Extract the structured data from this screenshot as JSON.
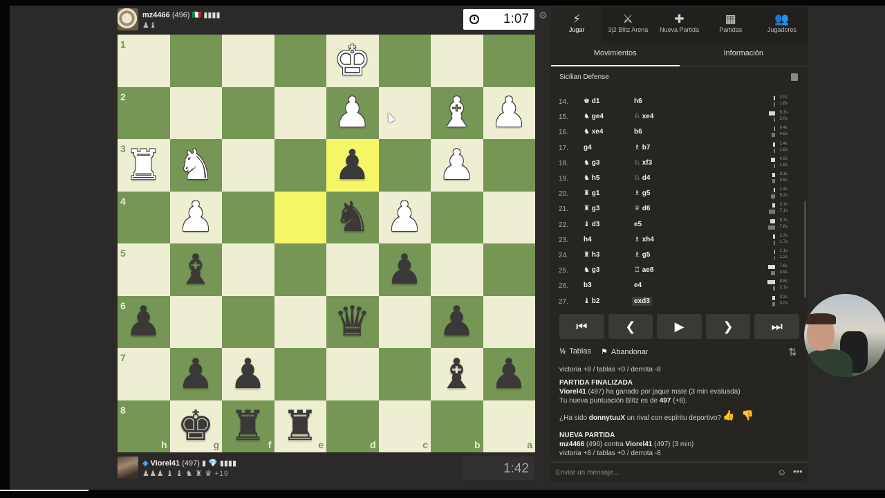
{
  "top_player": {
    "username": "mz4466",
    "rating": "(496)",
    "flag": "🇮🇹 ▮▮▮▮",
    "captured": "♟♝",
    "clock": "1:07"
  },
  "bottom_player": {
    "username": "Viorel41",
    "rating": "(497)",
    "flag": "▮ 💎 ▮▮▮▮",
    "captured": "♟♟♟ ♝ ♝ ♞ ♜ ♛",
    "advantage": "+19",
    "clock": "1:42"
  },
  "board": {
    "ranks": [
      "1",
      "2",
      "3",
      "4",
      "5",
      "6",
      "7",
      "8"
    ],
    "files": [
      "h",
      "g",
      "f",
      "e",
      "d",
      "c",
      "b",
      "a"
    ],
    "pieces": [
      {
        "r": 0,
        "c": 4,
        "g": "♚",
        "s": "w"
      },
      {
        "r": 1,
        "c": 4,
        "g": "♟",
        "s": "w"
      },
      {
        "r": 1,
        "c": 6,
        "g": "♝",
        "s": "w"
      },
      {
        "r": 1,
        "c": 7,
        "g": "♟",
        "s": "w"
      },
      {
        "r": 2,
        "c": 0,
        "g": "♜",
        "s": "w"
      },
      {
        "r": 2,
        "c": 1,
        "g": "♞",
        "s": "w"
      },
      {
        "r": 2,
        "c": 4,
        "g": "♟",
        "s": "b"
      },
      {
        "r": 2,
        "c": 6,
        "g": "♟",
        "s": "w"
      },
      {
        "r": 3,
        "c": 1,
        "g": "♟",
        "s": "w"
      },
      {
        "r": 3,
        "c": 4,
        "g": "♞",
        "s": "b"
      },
      {
        "r": 3,
        "c": 5,
        "g": "♟",
        "s": "w"
      },
      {
        "r": 4,
        "c": 1,
        "g": "♝",
        "s": "b"
      },
      {
        "r": 4,
        "c": 5,
        "g": "♟",
        "s": "b"
      },
      {
        "r": 5,
        "c": 0,
        "g": "♟",
        "s": "b"
      },
      {
        "r": 5,
        "c": 4,
        "g": "♛",
        "s": "b"
      },
      {
        "r": 5,
        "c": 6,
        "g": "♟",
        "s": "b"
      },
      {
        "r": 6,
        "c": 1,
        "g": "♟",
        "s": "b"
      },
      {
        "r": 6,
        "c": 2,
        "g": "♟",
        "s": "b"
      },
      {
        "r": 6,
        "c": 6,
        "g": "♝",
        "s": "b"
      },
      {
        "r": 6,
        "c": 7,
        "g": "♟",
        "s": "b"
      },
      {
        "r": 7,
        "c": 1,
        "g": "♚",
        "s": "b"
      },
      {
        "r": 7,
        "c": 2,
        "g": "♜",
        "s": "b"
      },
      {
        "r": 7,
        "c": 3,
        "g": "♜",
        "s": "b"
      }
    ],
    "highlights": [
      [
        2,
        4
      ],
      [
        3,
        3
      ]
    ]
  },
  "nav": [
    {
      "icon": "⚡",
      "label": "Jugar"
    },
    {
      "icon": "⚔",
      "label": "3|2 Blitz Arena"
    },
    {
      "icon": "✚",
      "label": "Nueva Partida"
    },
    {
      "icon": "▦",
      "label": "Partidas"
    },
    {
      "icon": "👥",
      "label": "Jugadores"
    }
  ],
  "tabs": [
    "Movimientos",
    "Información"
  ],
  "opening": "Sicilian Defense",
  "moves": [
    {
      "n": "14.",
      "w": "♚ d1",
      "b": "h6",
      "tw": "2.0s",
      "tb": "1.8s",
      "bw": 2,
      "bb": 2
    },
    {
      "n": "15.",
      "w": "♞ ge4",
      "b": "♘ xe4",
      "tw": "6.7s",
      "tb": "2.0s",
      "bw": 9,
      "bb": 2
    },
    {
      "n": "16.",
      "w": "♞ xe4",
      "b": "b6",
      "tw": "0.4s",
      "tb": "4.6s",
      "bw": 1,
      "bb": 5
    },
    {
      "n": "17.",
      "w": "g4",
      "b": "♗ b7",
      "tw": "2.4s",
      "tb": "1.8s",
      "bw": 3,
      "bb": 2
    },
    {
      "n": "18.",
      "w": "♞ g3",
      "b": "♘ xf3",
      "tw": "4.9s",
      "tb": "1.9s",
      "bw": 6,
      "bb": 2
    },
    {
      "n": "19.",
      "w": "♞ h5",
      "b": "♘ d4",
      "tw": "3.1s",
      "tb": "3.5s",
      "bw": 4,
      "bb": 4
    },
    {
      "n": "20.",
      "w": "♜ g1",
      "b": "♗ g5",
      "tw": "1.4s",
      "tb": "5.2s",
      "bw": 2,
      "bb": 6
    },
    {
      "n": "21.",
      "w": "♜ g3",
      "b": "♕ d6",
      "tw": "3.1s",
      "tb": "7.1s",
      "bw": 4,
      "bb": 9
    },
    {
      "n": "22.",
      "w": "♝ d3",
      "b": "e5",
      "tw": "5.7s",
      "tb": "7.8s",
      "bw": 7,
      "bb": 10
    },
    {
      "n": "23.",
      "w": "h4",
      "b": "♗ xh4",
      "tw": "2.2s",
      "tb": "1.7s",
      "bw": 3,
      "bb": 2
    },
    {
      "n": "24.",
      "w": "♜ h3",
      "b": "♗ g5",
      "tw": "1.1s",
      "tb": "1.2s",
      "bw": 1,
      "bb": 1
    },
    {
      "n": "25.",
      "w": "♞ g3",
      "b": "♖ ae8",
      "tw": "7.6s",
      "tb": "4.9s",
      "bw": 10,
      "bb": 6
    },
    {
      "n": "26.",
      "w": "b3",
      "b": "e4",
      "tw": "8.8s",
      "tb": "2.1s",
      "bw": 11,
      "bb": 3
    },
    {
      "n": "27.",
      "w": "♝ b2",
      "b": "exd3",
      "tw": "3.2s",
      "tb": "3.0s",
      "bw": 4,
      "bb": 4
    }
  ],
  "controls": [
    "⏮",
    "❮",
    "▶",
    "❯",
    "⏭"
  ],
  "actions": {
    "draw_icon": "½",
    "draw": "Tablas",
    "resign": "Abandonar"
  },
  "chat": {
    "line1": "victoria +8 / tablas +0 / derrota -8",
    "finished_title": "PARTIDA FINALIZADA",
    "winner": "Viorel41",
    "win_text": "(497) ha ganado por jaque mate (3 min evaluada)",
    "rating_text": "Tu nueva puntuación Blitz es de",
    "new_rating": "497",
    "rating_delta": "(+8).",
    "rival_q1": "¿Ha sido",
    "rival_name": "donnytuuX",
    "rival_q2": "un rival con espíritu deportivo?",
    "new_game_title": "NUEVA PARTIDA",
    "p1": "mz4466",
    "p1_rating": "(496) contra",
    "p2": "Viorel41",
    "p2_rating": "(497) (3 min)",
    "line_last": "victoria +8 / tablas +0 / derrota -8",
    "input_placeholder": "Enviar un mensaje..."
  },
  "colors": {
    "light": "#eeeed2",
    "dark": "#769656",
    "highlight": "#f6f669",
    "panel": "#262522"
  }
}
